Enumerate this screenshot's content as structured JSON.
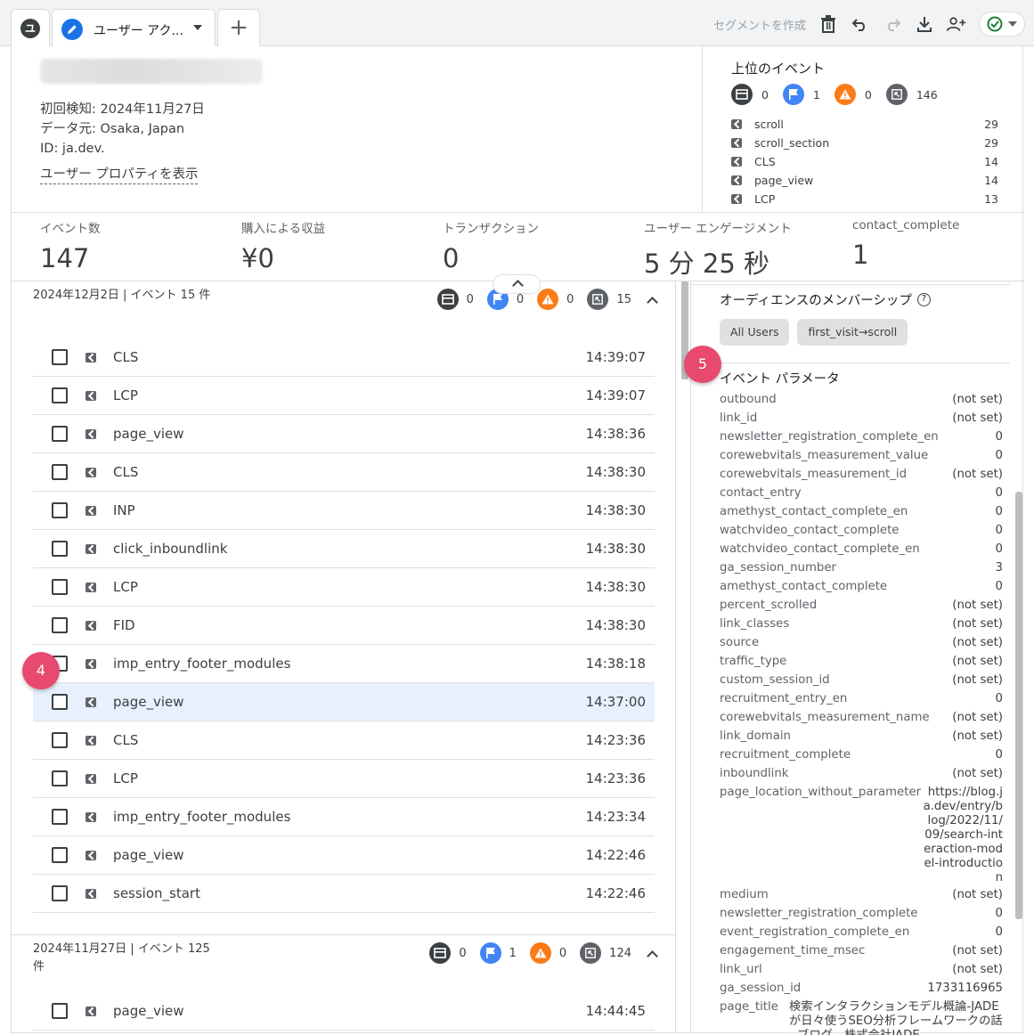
{
  "tabs": {
    "home_letter": "ユ",
    "active_label": "ユーザー アク...",
    "add_label": "+"
  },
  "toolbar": {
    "segment_link": "セグメントを作成",
    "icons": [
      "delete-icon",
      "undo-icon",
      "redo-icon",
      "download-icon",
      "share-users-icon",
      "check-status-icon"
    ]
  },
  "user": {
    "first_seen": "初回検知: 2024年11月27日",
    "location": "データ元: Osaka, Japan",
    "id": "ID: ja.dev.",
    "properties_link": "ユーザー プロパティを表示"
  },
  "top_events": {
    "title": "上位のイベント",
    "counts": {
      "dark": "0",
      "flag": "1",
      "warn": "0",
      "event": "146"
    },
    "items": [
      {
        "name": "scroll",
        "count": "29"
      },
      {
        "name": "scroll_section",
        "count": "29"
      },
      {
        "name": "CLS",
        "count": "14"
      },
      {
        "name": "page_view",
        "count": "14"
      },
      {
        "name": "LCP",
        "count": "13"
      }
    ]
  },
  "metrics": [
    {
      "label": "イベント数",
      "value": "147"
    },
    {
      "label": "購入による収益",
      "value": "¥0"
    },
    {
      "label": "トランザクション",
      "value": "0"
    },
    {
      "label": "ユーザー エンゲージメント",
      "value": "5 分 25 秒"
    },
    {
      "label": "contact_complete",
      "value": "1"
    }
  ],
  "days": [
    {
      "title": "2024年12月2日 | イベント 15 件",
      "counts": {
        "dark": "0",
        "flag": "0",
        "warn": "0",
        "event": "15"
      },
      "events": [
        {
          "name": "CLS",
          "time": "14:39:07"
        },
        {
          "name": "LCP",
          "time": "14:39:07"
        },
        {
          "name": "page_view",
          "time": "14:38:36"
        },
        {
          "name": "CLS",
          "time": "14:38:30"
        },
        {
          "name": "INP",
          "time": "14:38:30"
        },
        {
          "name": "click_inboundlink",
          "time": "14:38:30"
        },
        {
          "name": "LCP",
          "time": "14:38:30"
        },
        {
          "name": "FID",
          "time": "14:38:30"
        },
        {
          "name": "imp_entry_footer_modules",
          "time": "14:38:18"
        },
        {
          "name": "page_view",
          "time": "14:37:00"
        },
        {
          "name": "CLS",
          "time": "14:23:36"
        },
        {
          "name": "LCP",
          "time": "14:23:36"
        },
        {
          "name": "imp_entry_footer_modules",
          "time": "14:23:34"
        },
        {
          "name": "page_view",
          "time": "14:22:46"
        },
        {
          "name": "session_start",
          "time": "14:22:46"
        }
      ]
    },
    {
      "title": "2024年11月27日 | イベント 125 件",
      "counts": {
        "dark": "0",
        "flag": "1",
        "warn": "0",
        "event": "124"
      },
      "events": [
        {
          "name": "page_view",
          "time": "14:44:45"
        }
      ]
    }
  ],
  "badges": {
    "left": "4",
    "right": "5"
  },
  "panel": {
    "audience_title": "オーディエンスのメンバーシップ",
    "audience_chips": [
      "All Users",
      "first_visit→scroll"
    ],
    "params_title": "イベント パラメータ",
    "params": [
      {
        "k": "outbound",
        "v": "(not set)"
      },
      {
        "k": "link_id",
        "v": "(not set)"
      },
      {
        "k": "newsletter_registration_complete_en",
        "v": "0"
      },
      {
        "k": "corewebvitals_measurement_value",
        "v": "0"
      },
      {
        "k": "corewebvitals_measurement_id",
        "v": "(not set)"
      },
      {
        "k": "contact_entry",
        "v": "0"
      },
      {
        "k": "amethyst_contact_complete_en",
        "v": "0"
      },
      {
        "k": "watchvideo_contact_complete",
        "v": "0"
      },
      {
        "k": "watchvideo_contact_complete_en",
        "v": "0"
      },
      {
        "k": "ga_session_number",
        "v": "3"
      },
      {
        "k": "amethyst_contact_complete",
        "v": "0"
      },
      {
        "k": "percent_scrolled",
        "v": "(not set)"
      },
      {
        "k": "link_classes",
        "v": "(not set)"
      },
      {
        "k": "source",
        "v": "(not set)"
      },
      {
        "k": "traffic_type",
        "v": "(not set)"
      },
      {
        "k": "custom_session_id",
        "v": "(not set)"
      },
      {
        "k": "recruitment_entry_en",
        "v": "0"
      },
      {
        "k": "corewebvitals_measurement_name",
        "v": "(not set)"
      },
      {
        "k": "link_domain",
        "v": "(not set)"
      },
      {
        "k": "recruitment_complete",
        "v": "0"
      },
      {
        "k": "inboundlink",
        "v": "(not set)"
      },
      {
        "k": "page_location_without_parameter",
        "v": "https://blog.ja.dev/entry/blog/2022/11/09/search-interaction-model-introduction",
        "multi": true
      },
      {
        "k": "medium",
        "v": "(not set)"
      },
      {
        "k": "newsletter_registration_complete",
        "v": "0"
      },
      {
        "k": "event_registration_complete_en",
        "v": "0"
      },
      {
        "k": "engagement_time_msec",
        "v": "(not set)"
      },
      {
        "k": "link_url",
        "v": "(not set)"
      },
      {
        "k": "ga_session_id",
        "v": "1733116965"
      },
      {
        "k": "page_title",
        "v": "検索インタラクションモデル概論-JADEが日々使うSEO分析フレームワークの話 - ブログ - 株式会社JADE",
        "title": true
      }
    ]
  }
}
